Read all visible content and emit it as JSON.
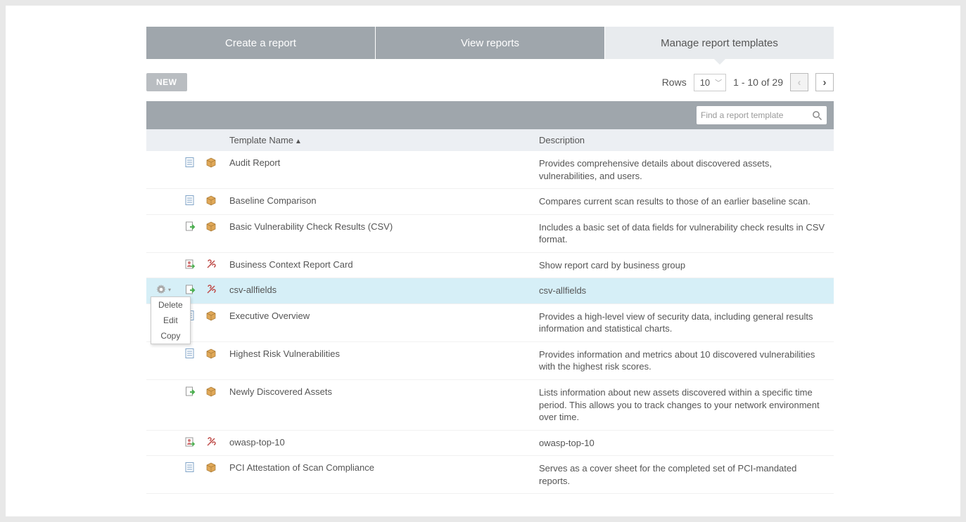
{
  "tabs": {
    "create": "Create a report",
    "view": "View reports",
    "manage": "Manage report templates"
  },
  "toolbar": {
    "new_label": "NEW",
    "rows_label": "Rows",
    "rows_value": "10",
    "range_text": "1 - 10 of 29"
  },
  "search": {
    "placeholder": "Find a report template"
  },
  "columns": {
    "name": "Template Name",
    "desc": "Description"
  },
  "dropdown": {
    "delete": "Delete",
    "edit": "Edit",
    "copy": "Copy"
  },
  "rows": [
    {
      "icons": [
        "doc",
        "box"
      ],
      "name": "Audit Report",
      "desc": "Provides comprehensive details about discovered assets, vulnerabilities, and users."
    },
    {
      "icons": [
        "doc",
        "box"
      ],
      "name": "Baseline Comparison",
      "desc": "Compares current scan results to those of an earlier baseline scan."
    },
    {
      "icons": [
        "export",
        "box"
      ],
      "name": "Basic Vulnerability Check Results (CSV)",
      "desc": "Includes a basic set of data fields for vulnerability check results in CSV format."
    },
    {
      "icons": [
        "person",
        "tools"
      ],
      "name": "Business Context Report Card",
      "desc": "Show report card by business group"
    },
    {
      "icons": [
        "export",
        "tools"
      ],
      "name": "csv-allfields",
      "desc": "csv-allfields",
      "highlight": true,
      "showGear": true
    },
    {
      "icons": [
        "doc",
        "box"
      ],
      "name": "Executive Overview",
      "desc": "Provides a high-level view of security data, including general results information and statistical charts."
    },
    {
      "icons": [
        "doc",
        "box"
      ],
      "name": "Highest Risk Vulnerabilities",
      "desc": "Provides information and metrics about 10 discovered vulnerabilities with the highest risk scores."
    },
    {
      "icons": [
        "export",
        "box"
      ],
      "name": "Newly Discovered Assets",
      "desc": "Lists information about new assets discovered within a specific time period. This allows you to track changes to your network environment over time."
    },
    {
      "icons": [
        "person",
        "tools"
      ],
      "name": "owasp-top-10",
      "desc": "owasp-top-10"
    },
    {
      "icons": [
        "doc",
        "box"
      ],
      "name": "PCI Attestation of Scan Compliance",
      "desc": "Serves as a cover sheet for the completed set of PCI-mandated reports."
    }
  ]
}
